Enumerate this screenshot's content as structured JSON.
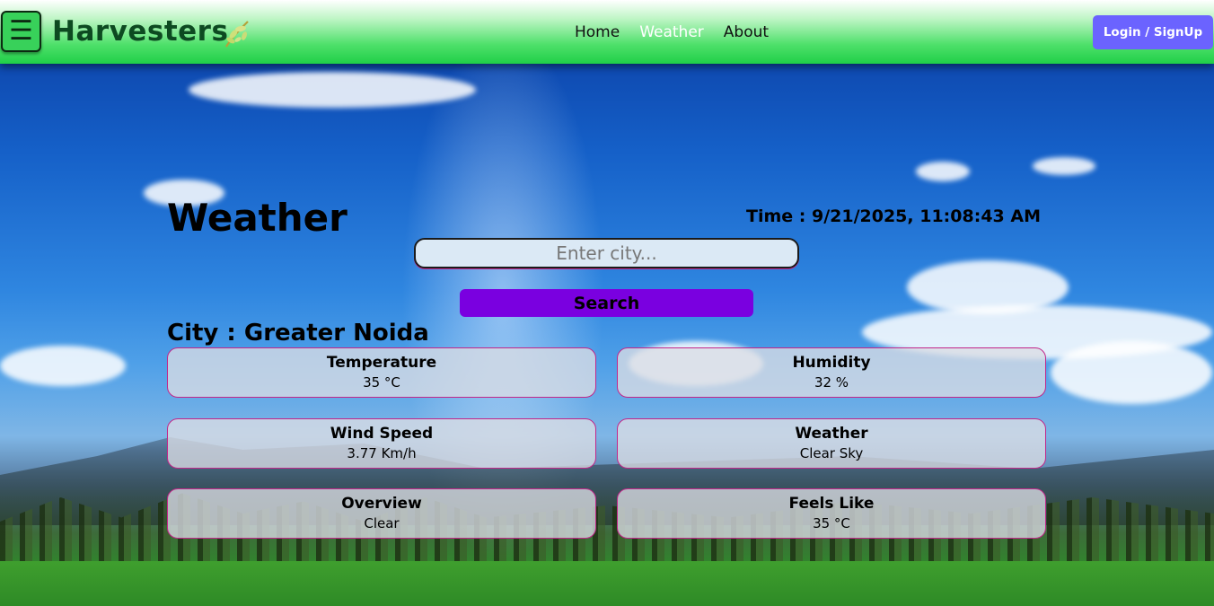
{
  "navbar": {
    "menu_icon": "hamburger-menu-icon",
    "brand": "Harvesters",
    "brand_icon": "leaf-icon",
    "links": [
      {
        "label": "Home",
        "active": false
      },
      {
        "label": "Weather",
        "active": true
      },
      {
        "label": "About",
        "active": false
      }
    ],
    "login_label": "Login / SignUp"
  },
  "main": {
    "title": "Weather",
    "time": "Time : 9/21/2025, 11:08:43 AM",
    "search": {
      "placeholder": "Enter city...",
      "value": "",
      "button_label": "Search"
    },
    "city": "City : Greater Noida",
    "cards": [
      {
        "title": "Temperature",
        "value": "35 °C"
      },
      {
        "title": "Humidity",
        "value": "32 %"
      },
      {
        "title": "Wind Speed",
        "value": "3.77 Km/h"
      },
      {
        "title": "Weather",
        "value": "Clear Sky"
      },
      {
        "title": "Overview",
        "value": "Clear"
      },
      {
        "title": "Feels Like",
        "value": "35 °C"
      }
    ]
  },
  "colors": {
    "navbar_green": "#20cf48",
    "brand_green": "#0d4a21",
    "login_purple": "#6b63ff",
    "search_button": "#7a00e0",
    "card_border": "#c2268a"
  }
}
